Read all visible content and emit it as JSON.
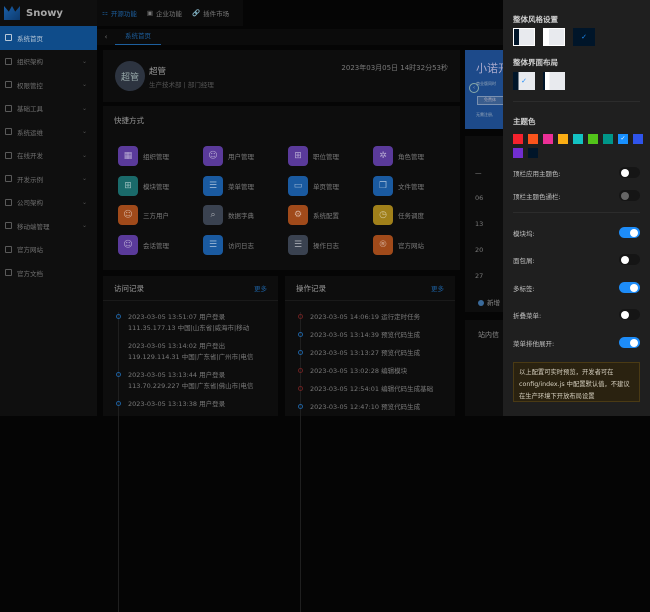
{
  "app": {
    "name": "Snowy"
  },
  "sidebar": {
    "items": [
      {
        "label": "系统首页",
        "active": true,
        "icon": "home-icon"
      },
      {
        "label": "组织架构",
        "icon": "org-icon"
      },
      {
        "label": "权限管控",
        "icon": "user-icon"
      },
      {
        "label": "基础工具",
        "icon": "tool-icon"
      },
      {
        "label": "系统运维",
        "icon": "ops-icon"
      },
      {
        "label": "在线开发",
        "icon": "dev-icon"
      },
      {
        "label": "开发示例",
        "icon": "example-icon"
      },
      {
        "label": "公司架构",
        "icon": "company-icon"
      },
      {
        "label": "移动端管理",
        "icon": "mobile-icon"
      },
      {
        "label": "官方网站",
        "icon": "website-icon"
      },
      {
        "label": "官方文档",
        "icon": "docs-icon"
      }
    ]
  },
  "topnav": [
    "开源功能",
    "企业功能",
    "插件市场"
  ],
  "tabs": {
    "active": "系统首页"
  },
  "user": {
    "avatar": "超管",
    "name": "超管",
    "dept": "生产技术部 | 部门经理",
    "time": "2023年03月05日 14时32分53秒"
  },
  "banner": {
    "title": "小诺开",
    "sub": "商业版同时",
    "button": "免费体",
    "note": "无需注册,"
  },
  "quick": {
    "title": "快捷方式",
    "items": [
      {
        "label": "组织管理",
        "color": "#5a3a9a",
        "glyph": "▦"
      },
      {
        "label": "用户管理",
        "color": "#5a3a9a",
        "glyph": "☺"
      },
      {
        "label": "职位管理",
        "color": "#5a3a9a",
        "glyph": "⊞"
      },
      {
        "label": "角色管理",
        "color": "#5a3a9a",
        "glyph": "✲"
      },
      {
        "label": "模块管理",
        "color": "#1a6a6a",
        "glyph": "⊞"
      },
      {
        "label": "菜单管理",
        "color": "#1a5aa0",
        "glyph": "☰"
      },
      {
        "label": "单页管理",
        "color": "#1a5aa0",
        "glyph": "▭"
      },
      {
        "label": "文件管理",
        "color": "#1a5aa0",
        "glyph": "❐"
      },
      {
        "label": "三方用户",
        "color": "#a04a1a",
        "glyph": "☺"
      },
      {
        "label": "数据字典",
        "color": "#3a4250",
        "glyph": "⌕"
      },
      {
        "label": "系统配置",
        "color": "#a04a1a",
        "glyph": "⚙"
      },
      {
        "label": "任务调度",
        "color": "#a0801a",
        "glyph": "◷"
      },
      {
        "label": "会话管理",
        "color": "#5a3a9a",
        "glyph": "☺"
      },
      {
        "label": "访问日志",
        "color": "#1a5aa0",
        "glyph": "☰"
      },
      {
        "label": "操作日志",
        "color": "#3a4250",
        "glyph": "☰"
      },
      {
        "label": "官方网站",
        "color": "#a04a1a",
        "glyph": "®"
      }
    ]
  },
  "visit": {
    "title": "访问记录",
    "more": "更多",
    "items": [
      {
        "line1": "2023-03-05 13:51:07 用户登录",
        "line2": "111.35.177.13 中国|山东省|威海市|移动",
        "dot": true
      },
      {
        "line1": "2023-03-05 13:14:02 用户登出",
        "line2": "119.129.114.31 中国|广东省|广州市|电信",
        "dot": false
      },
      {
        "line1": "2023-03-05 13:13:44 用户登录",
        "line2": "113.70.229.227 中国|广东省|佛山市|电信",
        "dot": true
      },
      {
        "line1": "2023-03-05 13:13:38 用户登录",
        "line2": "",
        "dot": true
      }
    ]
  },
  "oper": {
    "title": "操作记录",
    "more": "更多",
    "items": [
      {
        "text": "2023-03-05 14:06:19 运行定时任务",
        "red": true
      },
      {
        "text": "2023-03-05 13:14:39 预览代码生成",
        "red": false
      },
      {
        "text": "2023-03-05 13:13:27 预览代码生成",
        "red": false
      },
      {
        "text": "2023-03-05 13:02:28 编辑模块",
        "red": true
      },
      {
        "text": "2023-03-05 12:54:01 编辑代码生成基础",
        "red": true
      },
      {
        "text": "2023-03-05 12:47:10 预览代码生成",
        "red": false
      }
    ]
  },
  "calendar": {
    "header": "一",
    "days": [
      "06",
      "13",
      "20",
      "27"
    ],
    "add": "新增"
  },
  "messages": {
    "title": "站内信"
  },
  "drawer": {
    "style_title": "整体风格设置",
    "layout_title": "整体界面布局",
    "theme_title": "主题色",
    "theme_colors": [
      "#f5222d",
      "#fa541c",
      "#eb2f96",
      "#faad14",
      "#13c2c2",
      "#52c41a",
      "#009688",
      "#1890ff",
      "#2f54eb",
      "#722ed1",
      "#001529"
    ],
    "selected_color": "#1890ff",
    "toggles": [
      {
        "label": "顶栏应用主题色:",
        "on": false
      },
      {
        "label": "顶栏主题色通栏:",
        "on": false,
        "disabled": true
      },
      {
        "label": "模块坞:",
        "on": true
      },
      {
        "label": "面包屑:",
        "on": false
      },
      {
        "label": "多标签:",
        "on": true
      },
      {
        "label": "折叠菜单:",
        "on": false
      },
      {
        "label": "菜单排他展开:",
        "on": true
      }
    ],
    "note": "以上配置可实时预览，开发者可在 config/index.js 中配置默认值，不建议在生产环境下开放布局设置"
  }
}
